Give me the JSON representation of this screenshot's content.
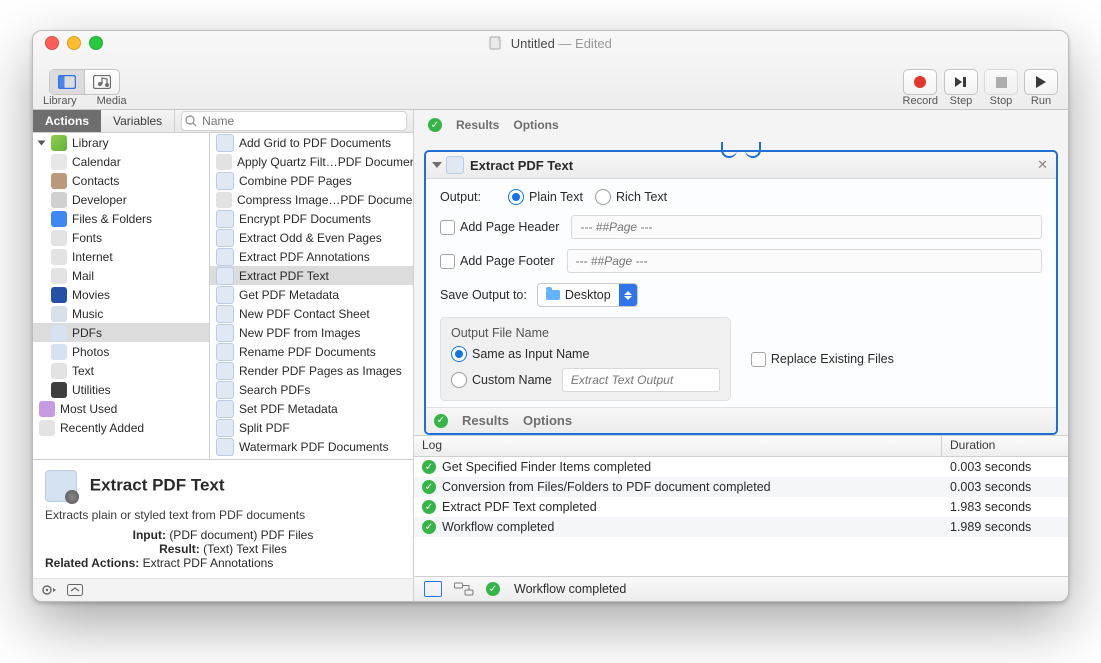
{
  "window": {
    "title": "Untitled",
    "subtitle": "— Edited"
  },
  "toolbar": {
    "library": "Library",
    "media": "Media",
    "record": "Record",
    "step": "Step",
    "stop": "Stop",
    "run": "Run"
  },
  "left_tabs": {
    "actions": "Actions",
    "variables": "Variables"
  },
  "search": {
    "placeholder": "Name"
  },
  "library_root": "Library",
  "library": [
    {
      "label": "Calendar",
      "ic": "cal"
    },
    {
      "label": "Contacts",
      "ic": "con"
    },
    {
      "label": "Developer",
      "ic": "dev"
    },
    {
      "label": "Files & Folders",
      "ic": "ff"
    },
    {
      "label": "Fonts",
      "ic": "font"
    },
    {
      "label": "Internet",
      "ic": "net"
    },
    {
      "label": "Mail",
      "ic": "mail"
    },
    {
      "label": "Movies",
      "ic": "mov"
    },
    {
      "label": "Music",
      "ic": "mus"
    },
    {
      "label": "PDFs",
      "ic": "pdf",
      "selected": true
    },
    {
      "label": "Photos",
      "ic": "photo"
    },
    {
      "label": "Text",
      "ic": "txt"
    },
    {
      "label": "Utilities",
      "ic": "util"
    }
  ],
  "library_extra": [
    {
      "label": "Most Used",
      "ic": "most"
    },
    {
      "label": "Recently Added",
      "ic": "recent"
    }
  ],
  "actions": [
    {
      "label": "Add Grid to PDF Documents",
      "ic": "doc"
    },
    {
      "label": "Apply Quartz Filt…PDF Documents",
      "ic": "tool"
    },
    {
      "label": "Combine PDF Pages",
      "ic": "doc"
    },
    {
      "label": "Compress Image…PDF Documents",
      "ic": "tool"
    },
    {
      "label": "Encrypt PDF Documents",
      "ic": "doc"
    },
    {
      "label": "Extract Odd & Even Pages",
      "ic": "doc"
    },
    {
      "label": "Extract PDF Annotations",
      "ic": "doc"
    },
    {
      "label": "Extract PDF Text",
      "ic": "doc",
      "selected": true
    },
    {
      "label": "Get PDF Metadata",
      "ic": "doc"
    },
    {
      "label": "New PDF Contact Sheet",
      "ic": "doc"
    },
    {
      "label": "New PDF from Images",
      "ic": "doc"
    },
    {
      "label": "Rename PDF Documents",
      "ic": "doc"
    },
    {
      "label": "Render PDF Pages as Images",
      "ic": "doc"
    },
    {
      "label": "Search PDFs",
      "ic": "doc"
    },
    {
      "label": "Set PDF Metadata",
      "ic": "doc"
    },
    {
      "label": "Split PDF",
      "ic": "doc"
    },
    {
      "label": "Watermark PDF Documents",
      "ic": "doc"
    }
  ],
  "detail": {
    "title": "Extract PDF Text",
    "desc": "Extracts plain or styled text from PDF documents",
    "input_label": "Input:",
    "input_value": "(PDF document) PDF Files",
    "result_label": "Result:",
    "result_value": "(Text) Text Files",
    "related_label": "Related Actions:",
    "related_value": "Extract PDF Annotations"
  },
  "results_options": {
    "results": "Results",
    "options": "Options"
  },
  "card": {
    "title": "Extract PDF Text",
    "output_label": "Output:",
    "output_plain": "Plain Text",
    "output_rich": "Rich Text",
    "add_header_label": "Add Page Header",
    "add_footer_label": "Add Page Footer",
    "page_placeholder": "--- ##Page ---",
    "save_label": "Save Output to:",
    "save_value": "Desktop",
    "ofn_title": "Output File Name",
    "ofn_same": "Same as Input Name",
    "ofn_custom": "Custom Name",
    "ofn_custom_placeholder": "Extract Text Output",
    "replace_label": "Replace Existing Files"
  },
  "log": {
    "col_log": "Log",
    "col_dur": "Duration",
    "rows": [
      {
        "msg": "Get Specified Finder Items completed",
        "dur": "0.003 seconds"
      },
      {
        "msg": "Conversion from Files/Folders to PDF document completed",
        "dur": "0.003 seconds"
      },
      {
        "msg": "Extract PDF Text completed",
        "dur": "1.983 seconds"
      },
      {
        "msg": "Workflow completed",
        "dur": "1.989 seconds"
      }
    ]
  },
  "footer_status": "Workflow completed"
}
